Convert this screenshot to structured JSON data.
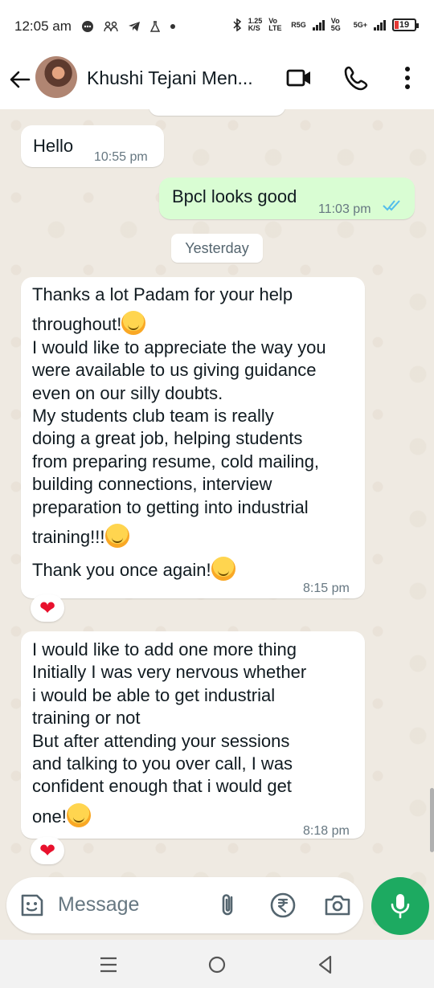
{
  "status_bar": {
    "time": "12:05 am",
    "speed_value": "1.25",
    "speed_unit": "K/S",
    "vo_lte": "Vo LTE",
    "r5g": "R5G",
    "vo_5g": "Vo 5G",
    "net_5g": "5G+",
    "battery": "19"
  },
  "header": {
    "contact_name": "Khushi Tejani Men..."
  },
  "messages": [
    {
      "direction": "in",
      "text": "Hello",
      "time": "10:55 pm"
    },
    {
      "direction": "out",
      "text": "Bpcl looks good",
      "time": "11:03 pm",
      "status": "read"
    },
    {
      "date_separator": "Yesterday"
    },
    {
      "direction": "in",
      "lines": [
        "Thanks a lot Padam for your help",
        "throughout!",
        "I would like to appreciate the way you",
        "were available to us giving guidance",
        "even on our silly doubts.",
        "My students club team is really",
        "doing a great job, helping students",
        "from preparing resume, cold mailing,",
        "building connections, interview",
        "preparation to getting into industrial",
        "training!!!",
        "Thank you once again!"
      ],
      "time": "8:15 pm",
      "reaction": "❤"
    },
    {
      "direction": "in",
      "lines": [
        "I would like to add one more thing",
        "Initially I was very nervous whether",
        "i would be able to get industrial",
        "training or not",
        "But after attending your sessions",
        "and talking to you over call, I was",
        "confident enough that i would get",
        "one!"
      ],
      "time": "8:18 pm",
      "reaction": "❤"
    }
  ],
  "composer": {
    "placeholder": "Message"
  },
  "colors": {
    "chat_bg": "#efeae2",
    "outgoing_bubble": "#d9fdd3",
    "incoming_bubble": "#ffffff",
    "accent_green": "#1daa61",
    "read_tick": "#53bdeb"
  }
}
